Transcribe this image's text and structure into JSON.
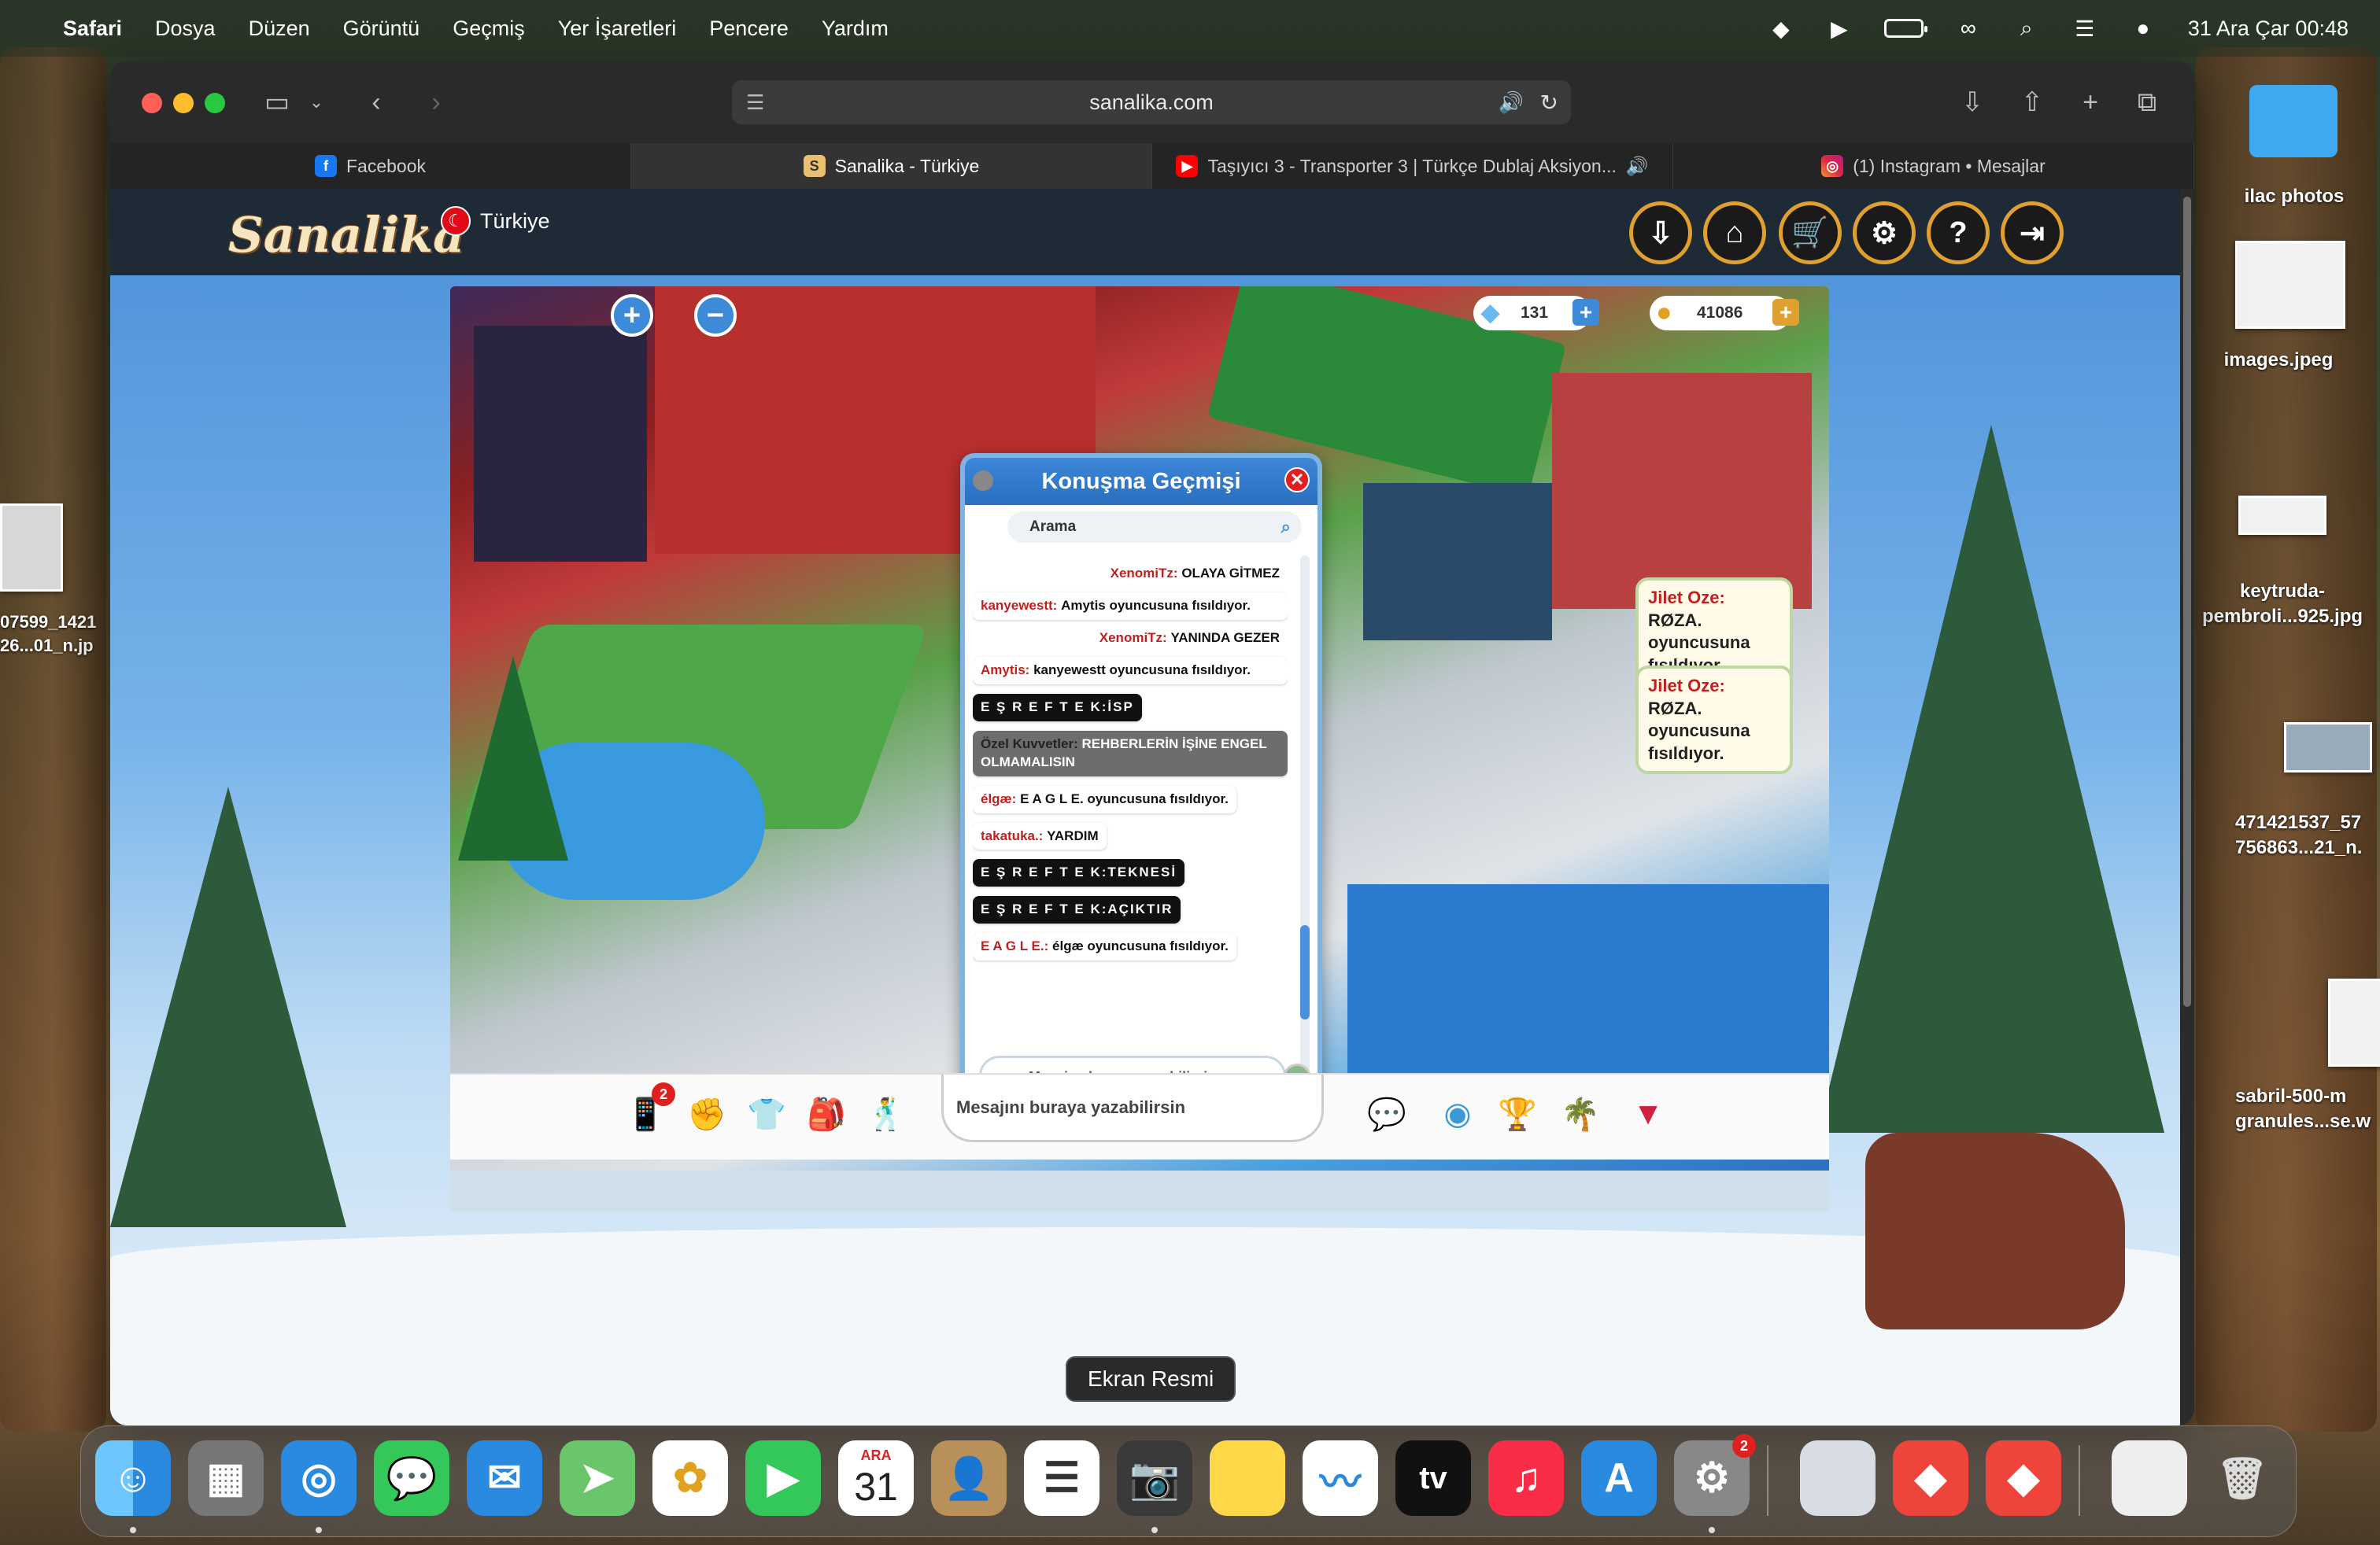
{
  "menubar": {
    "app": "Safari",
    "items": [
      "Dosya",
      "Düzen",
      "Görüntü",
      "Geçmiş",
      "Yer İşaretleri",
      "Pencere",
      "Yardım"
    ],
    "clock": "31 Ara Çar  00:48"
  },
  "browser": {
    "url": "sanalika.com",
    "tabs": [
      {
        "label": "Facebook",
        "icon": "facebook-icon"
      },
      {
        "label": "Sanalika - Türkiye",
        "icon": "sanalika-icon"
      },
      {
        "label": "Taşıyıcı 3 - Transporter 3 | Türkçe Dublaj Aksiyon...",
        "icon": "youtube-icon"
      },
      {
        "label": "(1) Instagram • Mesajlar",
        "icon": "instagram-icon"
      }
    ]
  },
  "site": {
    "logo": "Sanalika",
    "country": "Türkiye"
  },
  "game": {
    "diamonds": "131",
    "coins": "41086",
    "chat_history": {
      "title": "Konuşma Geçmişi",
      "search_placeholder": "Arama",
      "input_placeholder": "Mesajını buraya yazabilirsin",
      "messages": [
        {
          "nick": "XenomiTz:",
          "text": "OLAYA GİTMEZ"
        },
        {
          "nick": "kanyewestt:",
          "text": "Amytis oyuncusuna fısıldıyor."
        },
        {
          "nick": "XenomiTz:",
          "text": "YANINDA GEZER"
        },
        {
          "nick": "Amytis:",
          "text": "kanyewestt oyuncusuna fısıldıyor."
        },
        {
          "nick": "E Ş R E F T E K:",
          "text": "İSP"
        },
        {
          "nick": "Özel Kuvvetler:",
          "text": "REHBERLERİN İŞİNE ENGEL OLMAMALISIN"
        },
        {
          "nick": "élgæ:",
          "text": "E A G L E. oyuncusuna fısıldıyor."
        },
        {
          "nick": "takatuka.:",
          "text": "YARDIM"
        },
        {
          "nick": "E Ş R E F T E K:",
          "text": "TEKNESİ"
        },
        {
          "nick": "E Ş R E F T E K:",
          "text": "AÇIKTIR"
        },
        {
          "nick": "E A G L E.:",
          "text": "élgæ oyuncusuna fısıldıyor."
        }
      ]
    },
    "bubbles": [
      {
        "nick": "Jilet Oze:",
        "text": "RØZA. oyuncusuna fısıldıyor."
      },
      {
        "nick": "Jilet Oze:",
        "text": "RØZA. oyuncusuna fısıldıyor."
      }
    ],
    "main_input_placeholder": "Mesajını buraya yazabilirsin",
    "phone_badge": "2"
  },
  "tooltip": "Ekran Resmi",
  "desktop": {
    "icons": [
      {
        "label": "ilac photos"
      },
      {
        "label": "images.jpeg"
      },
      {
        "label": "keytruda-\npembroli...925.jpg"
      },
      {
        "label": "471421537_57\n756863...21_n."
      },
      {
        "label": "sabril-500-m\ngranules...se.w"
      }
    ],
    "left_icon": "07599_1421\n26...01_n.jp"
  },
  "dock": {
    "calendar_month": "ARA",
    "calendar_day": "31",
    "settings_badge": "2",
    "tv_label": "tv"
  }
}
